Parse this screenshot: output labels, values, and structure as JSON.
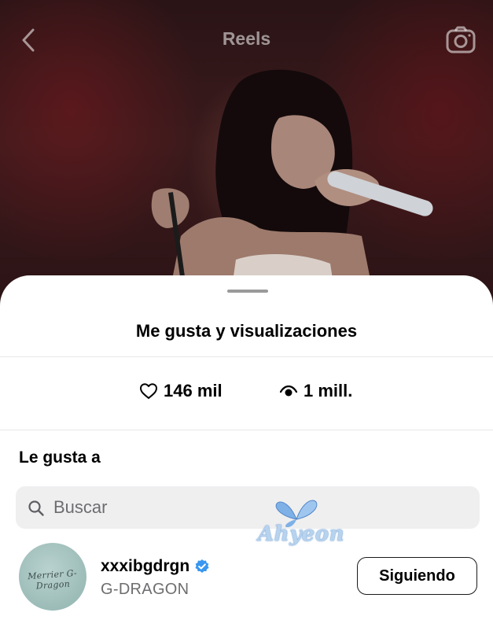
{
  "header": {
    "title": "Reels",
    "back_icon": "chevron-left-icon",
    "camera_icon": "camera-icon"
  },
  "sheet": {
    "title": "Me gusta y visualizaciones",
    "stats": {
      "likes": {
        "icon": "heart-icon",
        "value": "146 mil"
      },
      "views": {
        "icon": "eye-icon",
        "value": "1 mill."
      }
    },
    "section_label": "Le gusta a",
    "search": {
      "placeholder": "Buscar",
      "value": ""
    },
    "users": [
      {
        "username": "xxxibgdrgn",
        "verified": true,
        "full_name": "G-DRAGON",
        "avatar_text": "Merrier G-Dragon",
        "button_label": "Siguiendo"
      }
    ]
  },
  "watermark": {
    "text": "Ahyeon"
  },
  "colors": {
    "verified_badge": "#3897f0",
    "watermark": "#b7d3ee",
    "search_bg": "#efeff0"
  }
}
